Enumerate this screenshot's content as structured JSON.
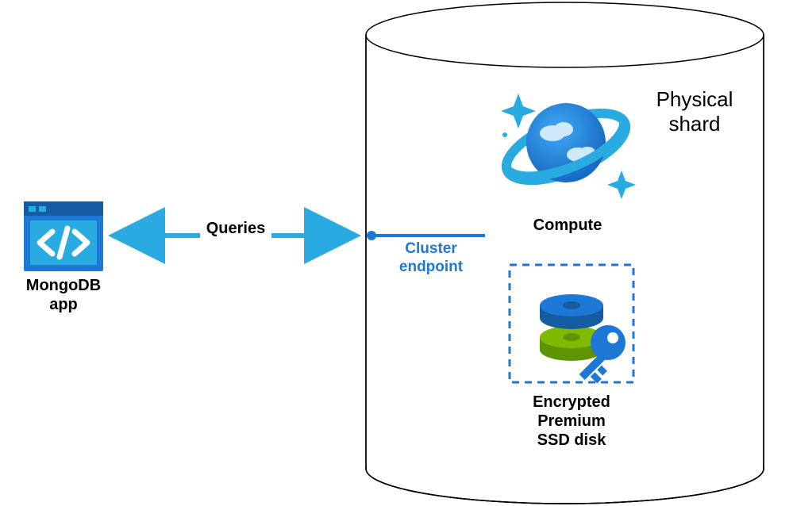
{
  "left_node": {
    "title_line1": "MongoDB",
    "title_line2": "app"
  },
  "connector": {
    "label": "Queries"
  },
  "endpoint": {
    "line1": "Cluster",
    "line2": "endpoint"
  },
  "shard": {
    "title_line1": "Physical",
    "title_line2": "shard",
    "compute_label": "Compute",
    "disk_line1": "Encrypted",
    "disk_line2": "Premium",
    "disk_line3": "SSD disk"
  },
  "colors": {
    "azure_light": "#29ABE2",
    "azure_mid": "#1E78D6",
    "azure_dark": "#155CA2",
    "green": "#7FBA00",
    "green_dark": "#5E9400"
  }
}
